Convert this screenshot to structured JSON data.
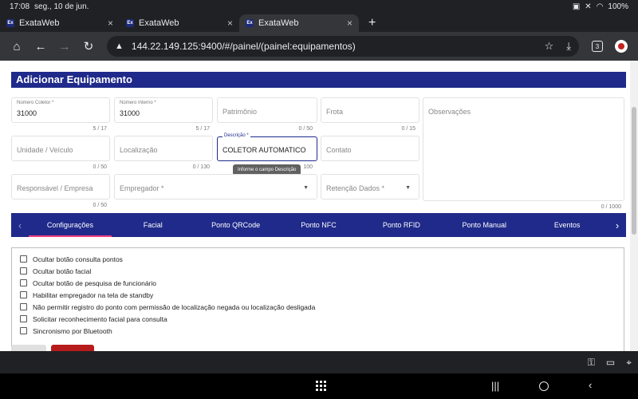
{
  "status": {
    "time": "17:08",
    "date": "seg., 10 de jun.",
    "battery": "100%"
  },
  "browser": {
    "tabs": [
      {
        "favicon": "Ex",
        "title": "ExataWeb"
      },
      {
        "favicon": "Ex",
        "title": "ExataWeb"
      },
      {
        "favicon": "Ex",
        "title": "ExataWeb"
      }
    ],
    "url": "144.22.149.125:9400/#/painel/(painel:equipamentos)",
    "tab_count": "3"
  },
  "form": {
    "title": "Adicionar Equipamento",
    "numero_coletor": {
      "label": "Número Coletor *",
      "value": "31000",
      "counter": "5 / 17"
    },
    "numero_interno": {
      "label": "Número Interno *",
      "value": "31000",
      "counter": "5 / 17"
    },
    "patrimonio": {
      "placeholder": "Patrimônio",
      "counter": "0 / 50"
    },
    "frota": {
      "placeholder": "Frota",
      "counter": "0 / 15"
    },
    "observacoes": {
      "placeholder": "Observações",
      "counter": "0 / 1000"
    },
    "unidade": {
      "placeholder": "Unidade / Veículo",
      "counter": "0 / 50"
    },
    "localizacao": {
      "placeholder": "Localização",
      "counter": "0 / 130"
    },
    "descricao": {
      "label": "Descrição *",
      "value": "COLETOR AUTOMATICO",
      "counter": "100",
      "tooltip": "Informe o campo Descrição"
    },
    "contato": {
      "placeholder": "Contato"
    },
    "responsavel": {
      "placeholder": "Responsável / Empresa",
      "counter": "0 / 50"
    },
    "empregador": {
      "placeholder": "Empregador *"
    },
    "retencao": {
      "placeholder": "Retenção Dados *"
    }
  },
  "tabs": [
    "Configurações",
    "Facial",
    "Ponto QRCode",
    "Ponto NFC",
    "Ponto RFID",
    "Ponto Manual",
    "Eventos"
  ],
  "config_options": [
    "Ocultar botão consulta pontos",
    "Ocultar botão facial",
    "Ocultar botão de pesquisa de funcionário",
    "Habilitar empregador na tela de standby",
    "Não permitir registro do ponto com permissão de localização negada ou localização desligada",
    "Solicitar reconhecimento facial para consulta",
    "Sincronismo por Bluetooth"
  ],
  "colors": {
    "primary": "#1f2a8a",
    "accent": "#ff4081",
    "danger": "#b71c1c"
  }
}
